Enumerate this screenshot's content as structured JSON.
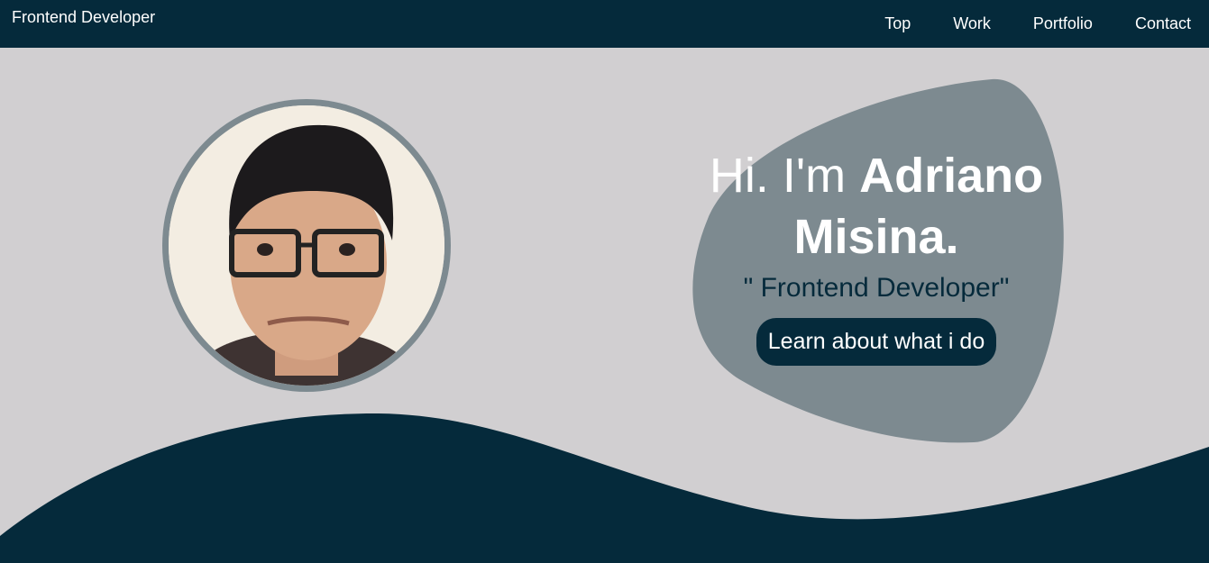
{
  "navbar": {
    "brand": "Frontend Developer",
    "links": [
      "Top",
      "Work",
      "Portfolio",
      "Contact"
    ]
  },
  "hero": {
    "greeting_prefix": "Hi. I'm ",
    "name_line1": "Adriano",
    "name_line2": "Misina.",
    "role": "\" Frontend Developer\"",
    "cta_label": "Learn about what i do"
  },
  "colors": {
    "primary_dark": "#052a3b",
    "background": "#d1cfd1",
    "blob": "#7d8a90",
    "text_light": "#ffffff"
  }
}
